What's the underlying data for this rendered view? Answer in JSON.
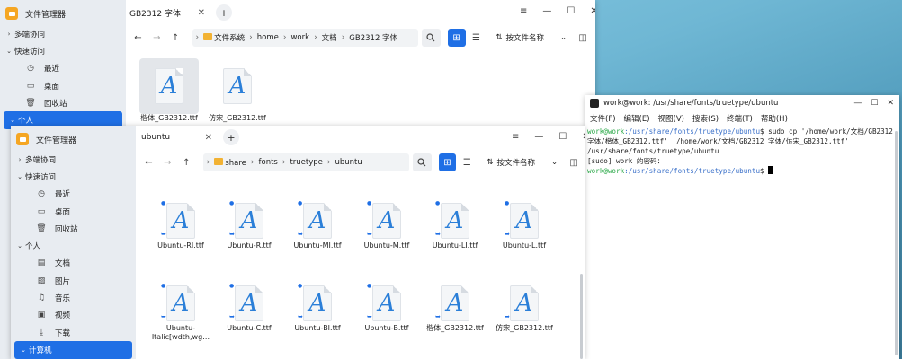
{
  "back_window": {
    "app_title": "文件管理器",
    "sidebar": [
      {
        "label": "多端协同",
        "arrow": "›"
      },
      {
        "label": "快速访问",
        "arrow": "⌄"
      },
      {
        "label": "最近",
        "icon": "◷"
      },
      {
        "label": "桌面",
        "icon": "▭"
      },
      {
        "label": "回收站",
        "icon": "🗑"
      },
      {
        "label": "个人",
        "arrow": "⌄"
      }
    ],
    "tab_label": "GB2312 字体",
    "breadcrumbs": [
      "文件系统",
      "home",
      "work",
      "文档",
      "GB2312 字体"
    ],
    "sort_label": "按文件名称",
    "files": [
      "楷体_GB2312.ttf",
      "仿宋_GB2312.ttf"
    ]
  },
  "front_window": {
    "app_title": "文件管理器",
    "sidebar": [
      {
        "label": "多端协同",
        "arrow": "›"
      },
      {
        "label": "快速访问",
        "arrow": "⌄"
      },
      {
        "label": "最近",
        "icon": "◷"
      },
      {
        "label": "桌面",
        "icon": "▭"
      },
      {
        "label": "回收站",
        "icon": "🗑"
      },
      {
        "label": "个人",
        "arrow": "⌄"
      },
      {
        "label": "文档",
        "icon": "▤"
      },
      {
        "label": "图片",
        "icon": "▨"
      },
      {
        "label": "音乐",
        "icon": "♫"
      },
      {
        "label": "视频",
        "icon": "▣"
      },
      {
        "label": "下载",
        "icon": "⤓"
      },
      {
        "label": "计算机",
        "arrow": "⌄"
      }
    ],
    "tab_label": "ubuntu",
    "breadcrumbs": [
      "share",
      "fonts",
      "truetype",
      "ubuntu"
    ],
    "sort_label": "按文件名称",
    "files": [
      "Ubuntu-RI.ttf",
      "Ubuntu-R.ttf",
      "Ubuntu-MI.ttf",
      "Ubuntu-M.ttf",
      "Ubuntu-LI.ttf",
      "Ubuntu-L.ttf",
      "Ubuntu-Italic[wdth,wg…",
      "Ubuntu-C.ttf",
      "Ubuntu-BI.ttf",
      "Ubuntu-B.ttf",
      "楷体_GB2312.ttf",
      "仿宋_GB2312.ttf"
    ],
    "file_line1": "Ubuntu-",
    "file_line2": "Italic[wdth,wg…"
  },
  "terminal": {
    "title": "work@work: /usr/share/fonts/truetype/ubuntu",
    "menu": [
      "文件(F)",
      "编辑(E)",
      "视图(V)",
      "搜索(S)",
      "终端(T)",
      "帮助(H)"
    ],
    "line1_user": "work@work",
    "line1_path": ":/usr/share/fonts/truetype/ubuntu",
    "line1_cmd": "$ sudo cp '/home/work/文档/GB2312 字体/楷体_GB2312.ttf' '/home/work/文档/GB2312 字体/仿宋_GB2312.ttf' /usr/share/fonts/truetype/ubuntu",
    "line2": "[sudo] work 的密码：",
    "line3_user": "work@work",
    "line3_path": ":/usr/share/fonts/truetype/ubuntu",
    "line3_prompt": "$ "
  },
  "window_controls": {
    "menu": "≡",
    "minimize": "—",
    "maximize": "☐",
    "close": "✕"
  },
  "colors": {
    "accent": "#1f6fe5",
    "prompt_user": "#27a745",
    "prompt_path": "#3a70c9"
  }
}
